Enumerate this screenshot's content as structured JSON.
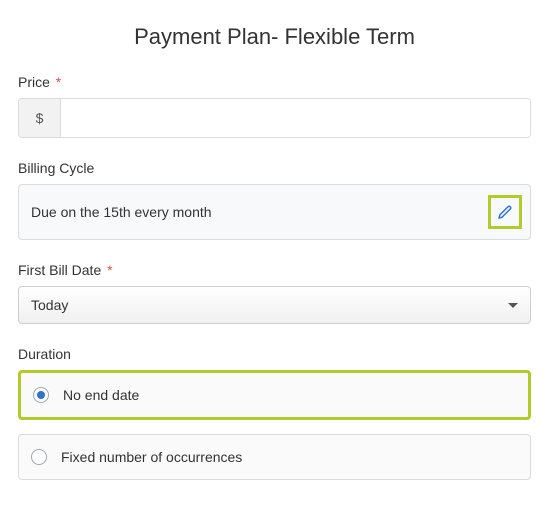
{
  "title": "Payment Plan- Flexible Term",
  "price": {
    "label": "Price",
    "required_marker": "*",
    "currency_symbol": "$",
    "value": ""
  },
  "billing_cycle": {
    "label": "Billing Cycle",
    "value": "Due on the 15th every month"
  },
  "first_bill_date": {
    "label": "First Bill Date",
    "required_marker": "*",
    "selected": "Today"
  },
  "duration": {
    "label": "Duration",
    "options": {
      "no_end": {
        "label": "No end date",
        "selected": true
      },
      "fixed": {
        "label": "Fixed number of occurrences",
        "selected": false
      }
    }
  }
}
